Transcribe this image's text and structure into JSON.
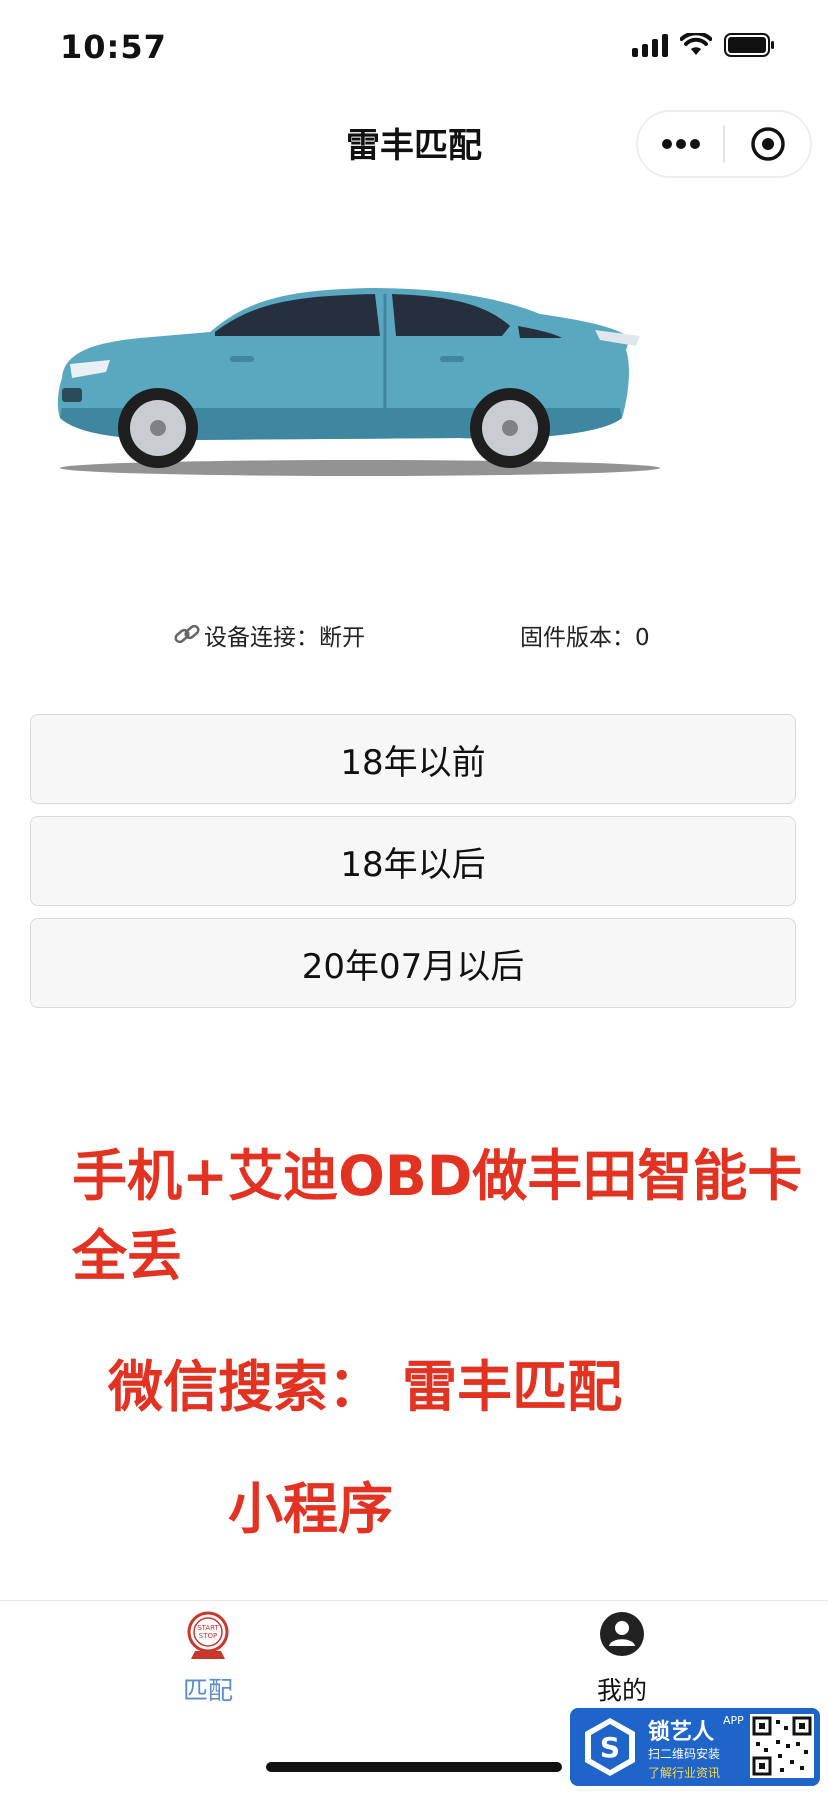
{
  "status_bar": {
    "time": "10:57"
  },
  "nav": {
    "title": "雷丰匹配"
  },
  "device": {
    "connection_label": "设备连接：断开",
    "firmware_label": "固件版本：0"
  },
  "options": [
    {
      "label": "18年以前"
    },
    {
      "label": "18年以后"
    },
    {
      "label": "20年07月以后"
    }
  ],
  "promo": {
    "line1": "手机+艾迪OBD做丰田智能卡全丢",
    "line2": "微信搜索： 雷丰匹配",
    "line3": "小程序"
  },
  "tabbar": {
    "tabs": [
      {
        "label": "匹配",
        "icon": "start-stop-icon",
        "active": true,
        "color": "#5b8ec8"
      },
      {
        "label": "我的",
        "icon": "user-icon",
        "active": false,
        "color": "#111111"
      }
    ]
  },
  "watermark": {
    "brand": "锁艺人",
    "badge": "APP",
    "line2": "扫二维码安装",
    "line3": "了解行业资讯"
  },
  "colors": {
    "accent_red": "#e23322",
    "tab_active": "#5b8ec8",
    "car_body": "#5aa7c0"
  }
}
